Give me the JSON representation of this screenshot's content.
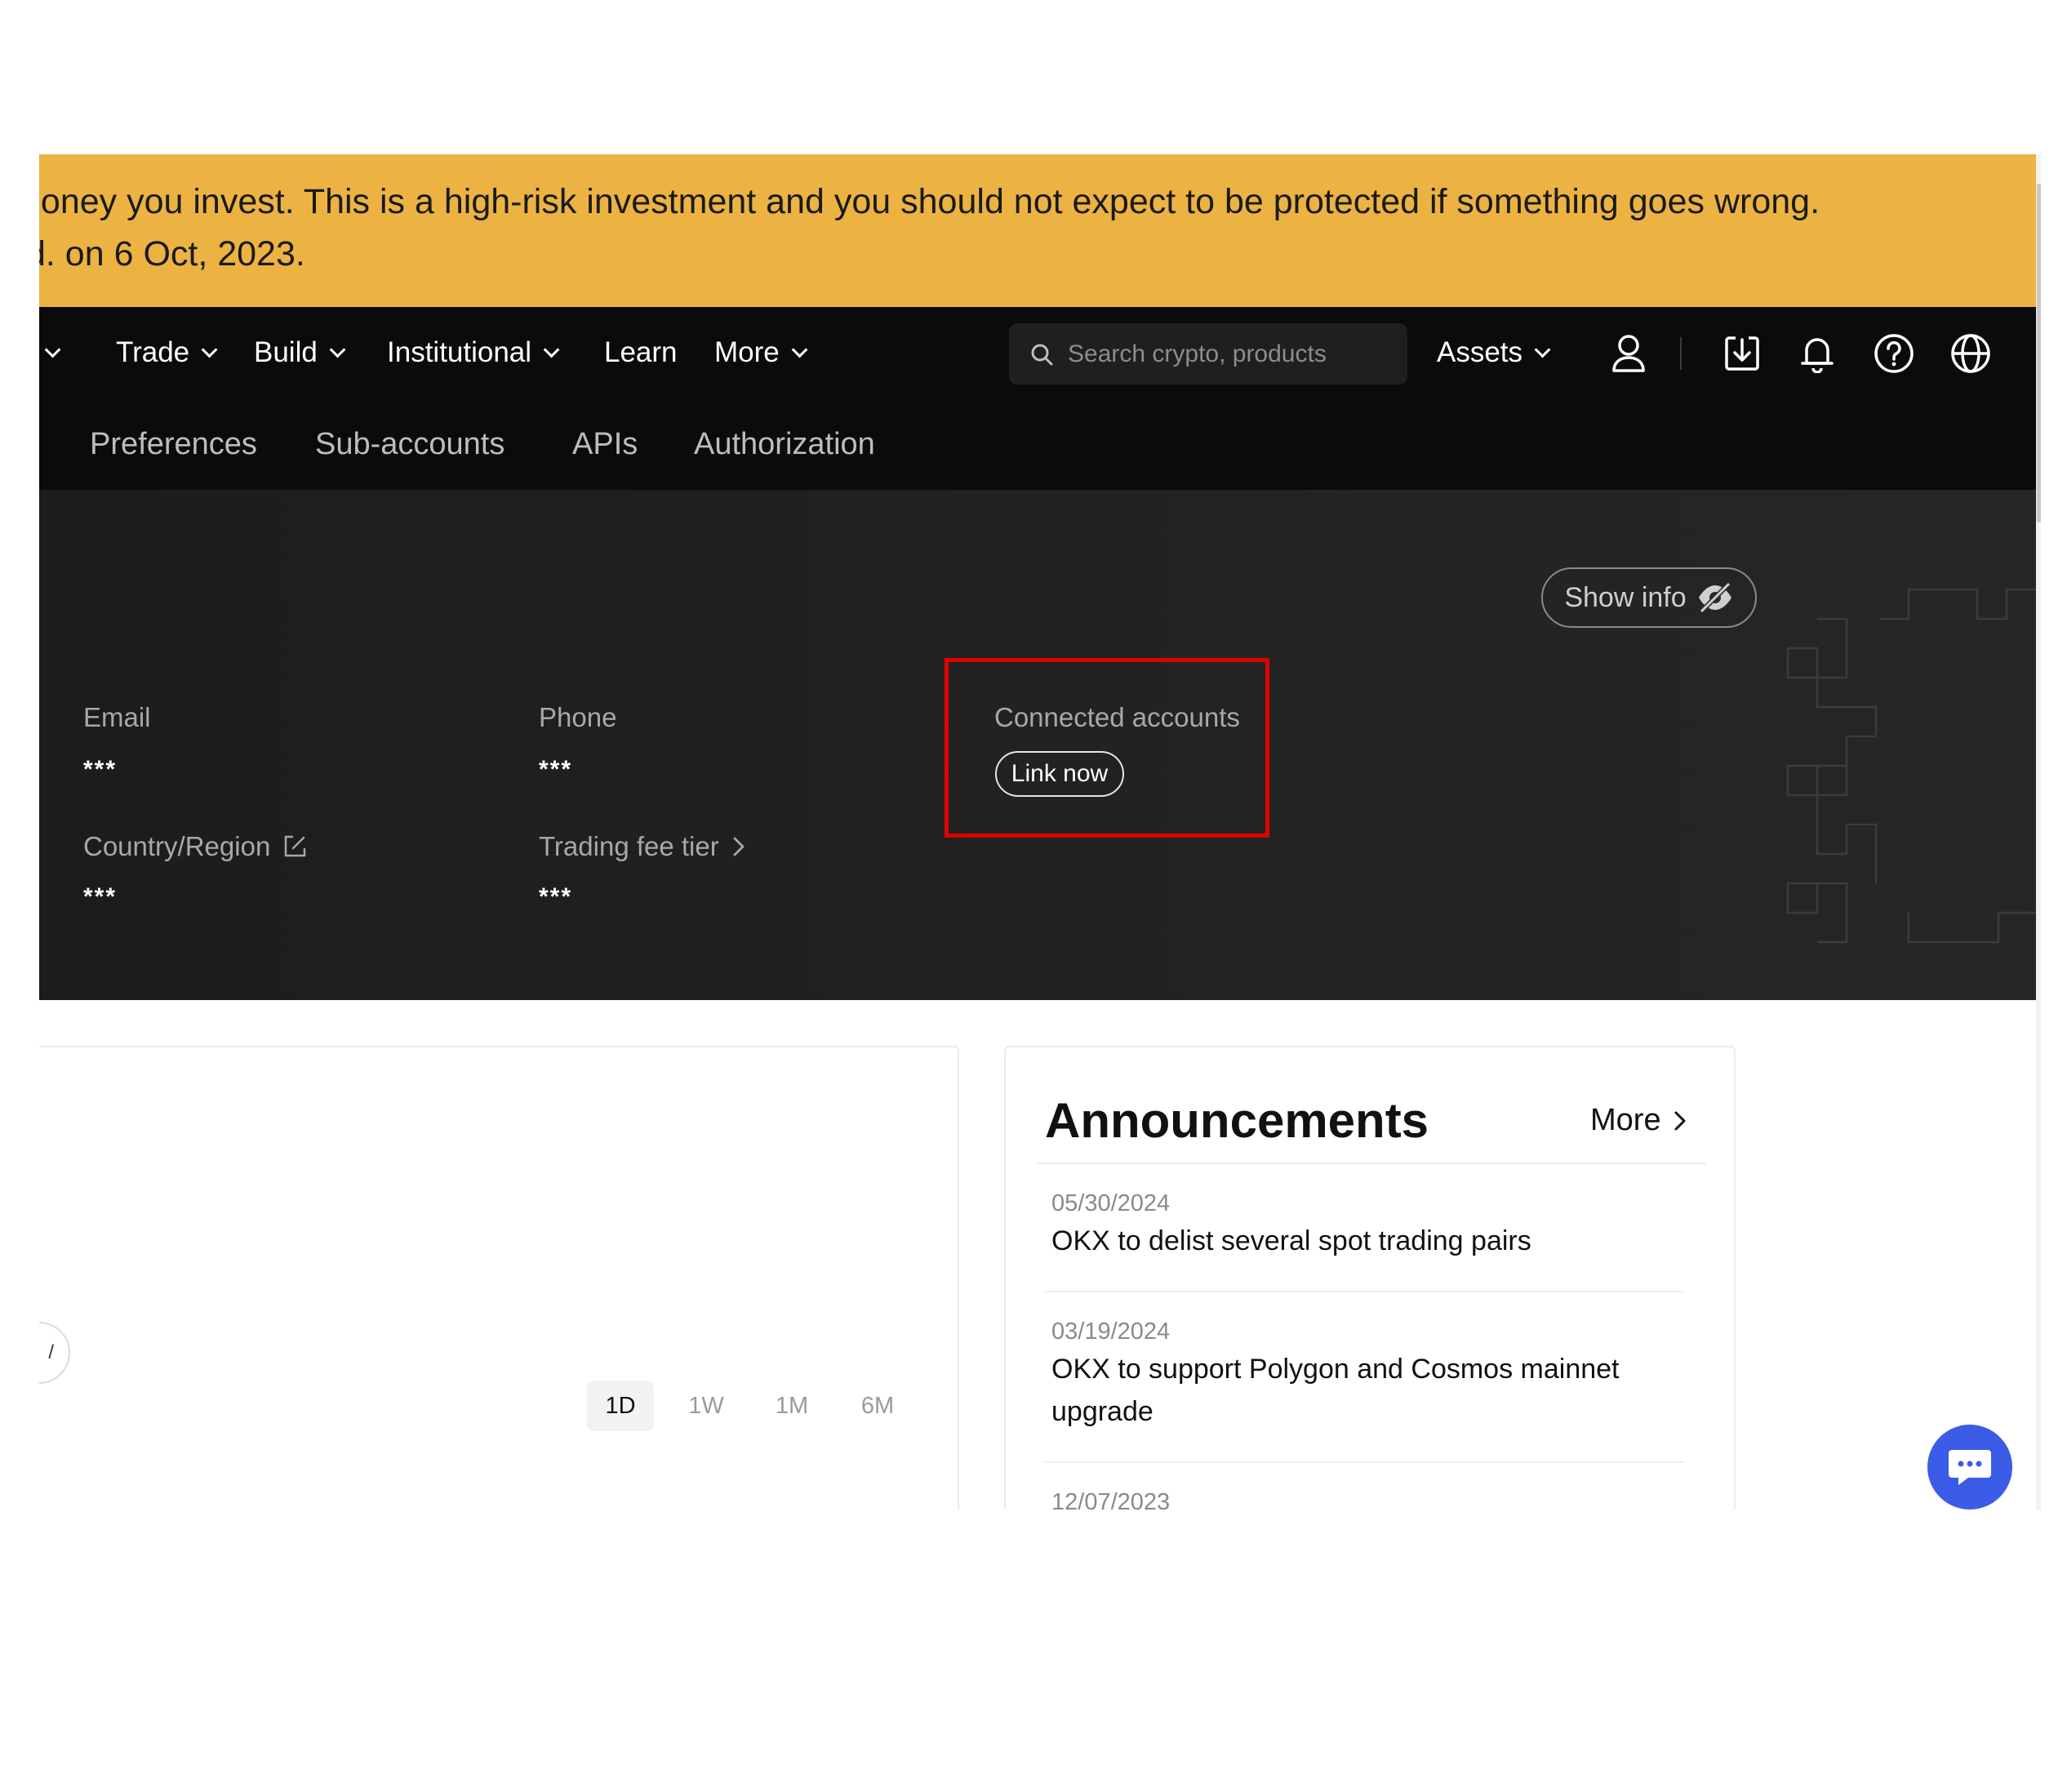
{
  "banner": {
    "line1": "noney you invest. This is a high-risk investment and you should not expect to be protected if something goes wrong.",
    "line2": "d. on 6 Oct, 2023."
  },
  "topnav": {
    "items": [
      {
        "label": "Trade"
      },
      {
        "label": "Build"
      },
      {
        "label": "Institutional"
      },
      {
        "label": "Learn"
      },
      {
        "label": "More"
      }
    ],
    "search_placeholder": "Search crypto, products",
    "assets_label": "Assets"
  },
  "subnav": {
    "items": [
      "Preferences",
      "Sub-accounts",
      "APIs",
      "Authorization"
    ]
  },
  "profile": {
    "show_info": "Show info",
    "email_label": "Email",
    "email_value": "***",
    "phone_label": "Phone",
    "phone_value": "***",
    "connected_label": "Connected accounts",
    "link_now": "Link now",
    "country_label": "Country/Region",
    "country_value": "***",
    "fee_label": "Trading fee tier",
    "fee_value": "***"
  },
  "chart_card": {
    "circle_glyph": "/",
    "periods": [
      "1D",
      "1W",
      "1M",
      "6M"
    ],
    "active_period": "1D"
  },
  "announcements": {
    "title": "Announcements",
    "more": "More",
    "items": [
      {
        "date": "05/30/2024",
        "text": "OKX to delist several spot trading pairs"
      },
      {
        "date": "03/19/2024",
        "text": "OKX to support Polygon and Cosmos mainnet upgrade"
      },
      {
        "date": "12/07/2023",
        "text": ""
      }
    ]
  },
  "colors": {
    "banner": "#ecb343",
    "nav_bg": "#0b0b0b",
    "highlight": "#e00000",
    "chat": "#3b5ce6"
  }
}
